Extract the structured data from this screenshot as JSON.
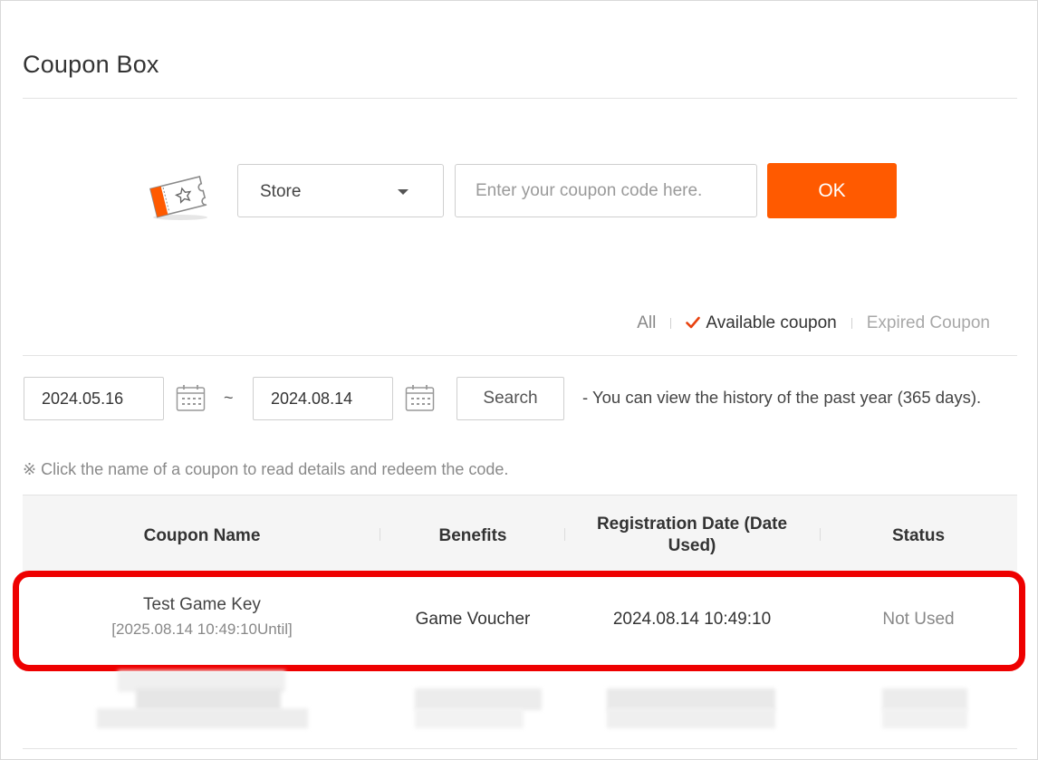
{
  "page": {
    "title": "Coupon Box"
  },
  "coupon_entry": {
    "platform_select": {
      "value": "Store"
    },
    "code_input": {
      "value": "",
      "placeholder": "Enter your coupon code here."
    },
    "ok_label": "OK",
    "accent_color": "#ff5a00"
  },
  "filters": {
    "items": [
      {
        "label": "All",
        "state": "normal"
      },
      {
        "label": "Available coupon",
        "state": "active",
        "icon": "check-icon"
      },
      {
        "label": "Expired Coupon",
        "state": "normal"
      }
    ]
  },
  "date_search": {
    "start_date": "2024.05.16",
    "separator": "~",
    "end_date": "2024.08.14",
    "search_label": "Search",
    "note": "- You can view the history of the past year (365 days)."
  },
  "hint": "※ Click the name of a coupon to read details and redeem the code.",
  "table": {
    "columns": [
      "Coupon Name",
      "Benefits",
      "Registration Date (Date Used)",
      "Status"
    ],
    "rows": [
      {
        "coupon_name": "Test Game Key",
        "valid_until": "[2025.08.14 10:49:10Until]",
        "benefits": "Game Voucher",
        "registration_date": "2024.08.14 10:49:10",
        "status": "Not Used"
      }
    ]
  },
  "annotation": {
    "highlight_color": "#ee0000"
  }
}
